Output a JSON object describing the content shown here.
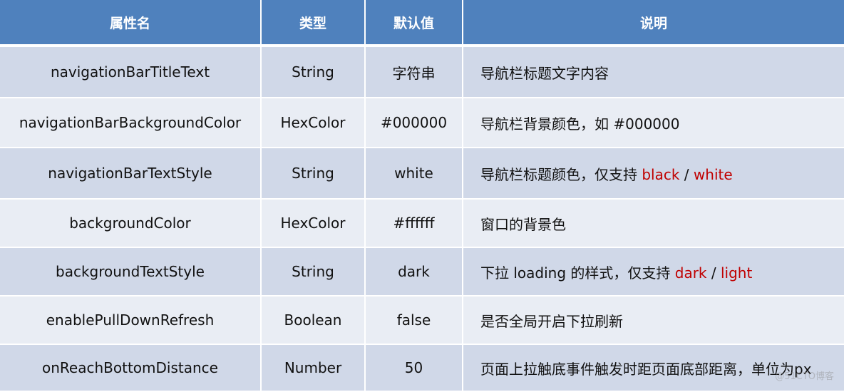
{
  "table": {
    "headers": [
      "属性名",
      "类型",
      "默认值",
      "说明"
    ],
    "rows": [
      {
        "name": "navigationBarTitleText",
        "type": "String",
        "default": "字符串",
        "desc_prefix": "导航栏标题文字内容",
        "options": []
      },
      {
        "name": "navigationBarBackgroundColor",
        "type": "HexColor",
        "default": "#000000",
        "desc_prefix": "导航栏背景颜色，如 #000000",
        "options": []
      },
      {
        "name": "navigationBarTextStyle",
        "type": "String",
        "default": "white",
        "desc_prefix": "导航栏标题颜色，仅支持 ",
        "options": [
          "black",
          "white"
        ],
        "separator": " / "
      },
      {
        "name": "backgroundColor",
        "type": "HexColor",
        "default": "#ffffff",
        "desc_prefix": "窗口的背景色",
        "options": []
      },
      {
        "name": "backgroundTextStyle",
        "type": "String",
        "default": "dark",
        "desc_prefix": "下拉 loading 的样式，仅支持 ",
        "options": [
          "dark",
          "light"
        ],
        "separator": " / "
      },
      {
        "name": "enablePullDownRefresh",
        "type": "Boolean",
        "default": "false",
        "desc_prefix": "是否全局开启下拉刷新",
        "options": []
      },
      {
        "name": "onReachBottomDistance",
        "type": "Number",
        "default": "50",
        "desc_prefix": "页面上拉触底事件触发时距页面底部距离，单位为px",
        "options": []
      }
    ]
  },
  "colors": {
    "header_bg": "#4F81BD",
    "row_dark": "#D0D8E8",
    "row_light": "#E9EDF4",
    "highlight": "#C00000"
  },
  "watermark": "@51CTO博客"
}
